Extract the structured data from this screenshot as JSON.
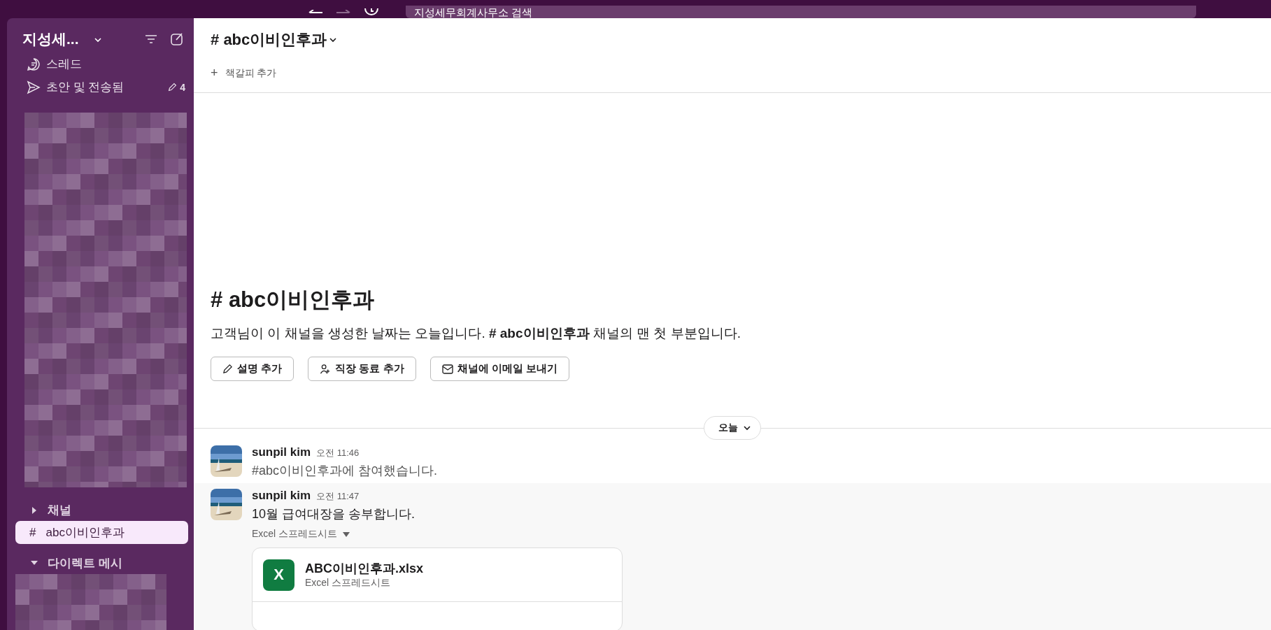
{
  "top_bar": {
    "search": {
      "value": "지성세무회계사무소 검색"
    }
  },
  "sidebar": {
    "workspace": "지성세...",
    "items": [
      {
        "kind": "thread",
        "label": "스레드"
      },
      {
        "kind": "drafts",
        "label": "초안 및 전송됨",
        "count": "4"
      }
    ],
    "sections": [
      {
        "label": "채널",
        "expanded": false,
        "channels": [
          {
            "prefix": "#",
            "name": "abc이비인후과",
            "selected": true
          }
        ]
      },
      {
        "label": "다이렉트 메시",
        "expanded": true
      }
    ]
  },
  "channel": {
    "prefix": "#",
    "name": "abc이비인후과",
    "bookmark": {
      "icon": "+",
      "label": "책갈피 추가"
    }
  },
  "intro": {
    "prefix": "#",
    "title": "abc이비인후과",
    "description": "고객님이 이 채널을 생성한 날짜는 오늘입니다. **# abc이비인후과** 채널의 맨 첫 부분입니다.",
    "buttons": [
      {
        "kind": "edit",
        "label": "설명 추가"
      },
      {
        "kind": "person",
        "label": "직장 동료 추가"
      },
      {
        "kind": "email",
        "label": "채널에 이메일 보내기"
      }
    ]
  },
  "date_divider": "오늘",
  "messages": [
    {
      "author": "sunpil kim",
      "time": "오전 11:46",
      "text": "#abc이비인후과에 참여했습니다.",
      "system": true
    },
    {
      "author": "sunpil kim",
      "time": "오전 11:47",
      "text": "10월 급여대장을 송부합니다.",
      "system": false,
      "attachment": {
        "section": "Excel 스프레드시트",
        "icon": "X",
        "name": "ABC이비인후과.xlsx",
        "type": "Excel 스프레드시트"
      }
    }
  ]
}
